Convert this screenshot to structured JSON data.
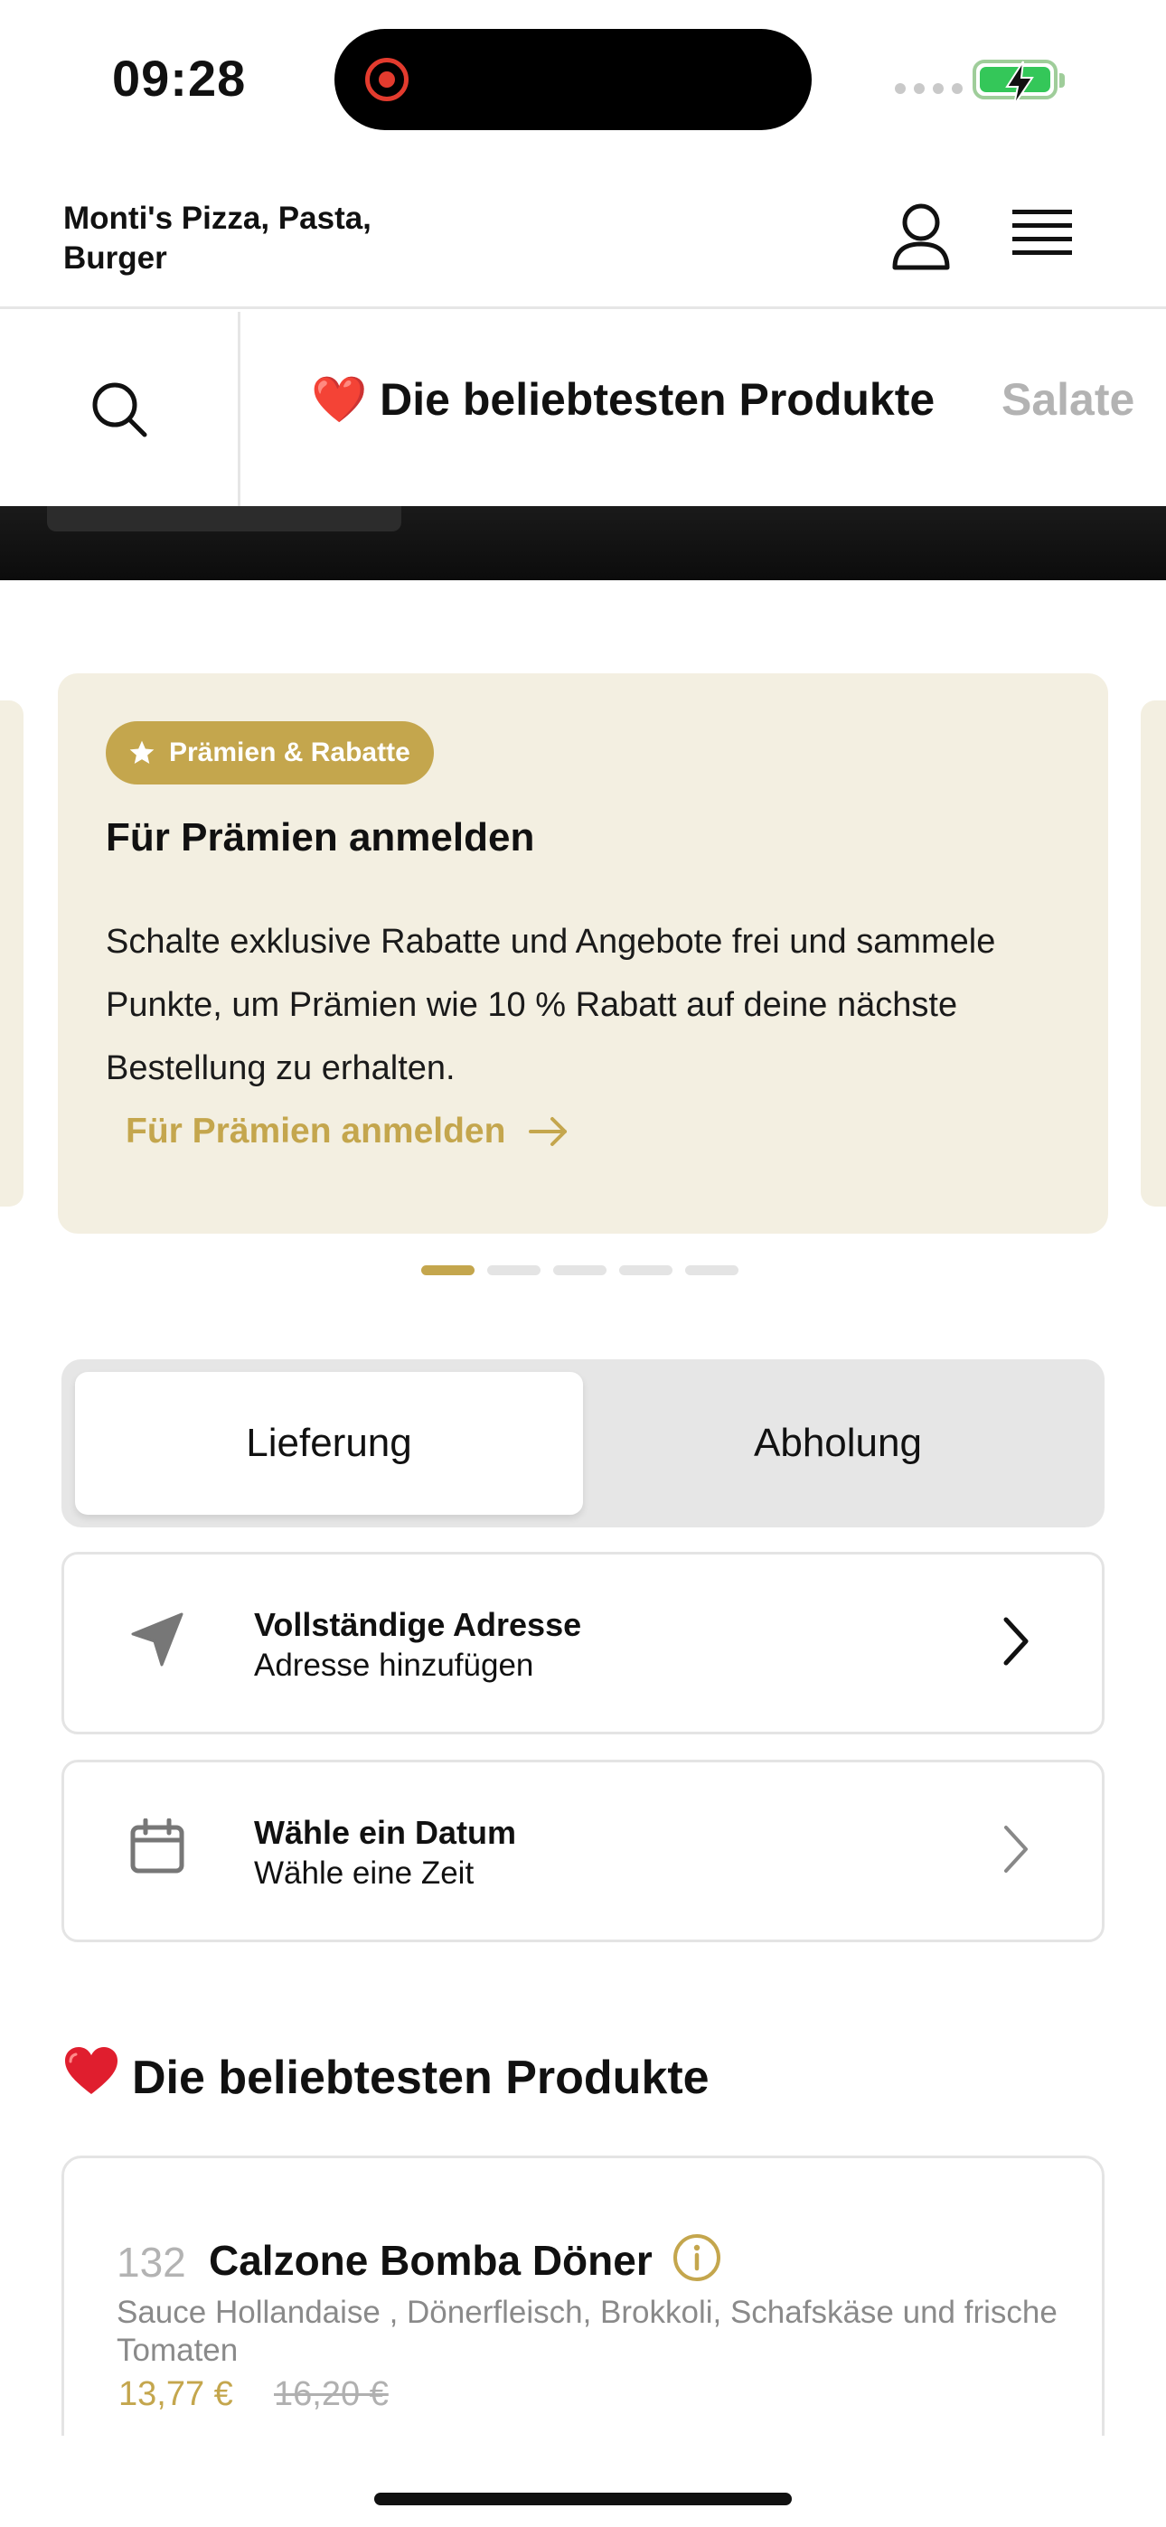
{
  "status_bar": {
    "time": "09:28"
  },
  "header": {
    "restaurant_name": "Monti's Pizza, Pasta, Burger",
    "user_icon": "user-icon",
    "menu_icon": "hamburger-menu-icon"
  },
  "category_bar": {
    "search_icon": "search-icon",
    "active_category": "❤️ Die beliebtesten Produkte",
    "next_category": "Salate"
  },
  "promo": {
    "badge_label": "Prämien & Rabatte",
    "badge_icon": "star-icon",
    "title": "Für Prämien anmelden",
    "text": "Schalte exklusive Rabatte und Angebote frei und sammele Punkte, um Prämien wie 10 % Rabatt auf deine nächste Bestellung zu erhalten.",
    "link_label": "Für Prämien anmelden",
    "link_icon": "arrow-right-icon",
    "accent_color": "#c4a64d",
    "card_color": "#f3efe1",
    "pagination": {
      "total": 5,
      "active_index": 0
    }
  },
  "delivery_toggle": {
    "options": [
      "Lieferung",
      "Abholung"
    ],
    "selected": "Lieferung"
  },
  "address_row": {
    "icon": "location-arrow-icon",
    "title": "Vollständige Adresse",
    "subtitle": "Adresse hinzufügen"
  },
  "date_row": {
    "icon": "calendar-icon",
    "title": "Wähle ein Datum",
    "subtitle": "Wähle eine Zeit"
  },
  "popular_section": {
    "title": "Die beliebtesten Produkte",
    "title_icon": "heart-icon"
  },
  "product": {
    "number": "132",
    "name": "Calzone Bomba Döner",
    "info_icon": "info-icon",
    "description": "Sauce Hollandaise , Dönerfleisch, Brokkoli, Schafskäse und frische Tomaten",
    "price": "13,77 €",
    "old_price": "16,20 €"
  }
}
